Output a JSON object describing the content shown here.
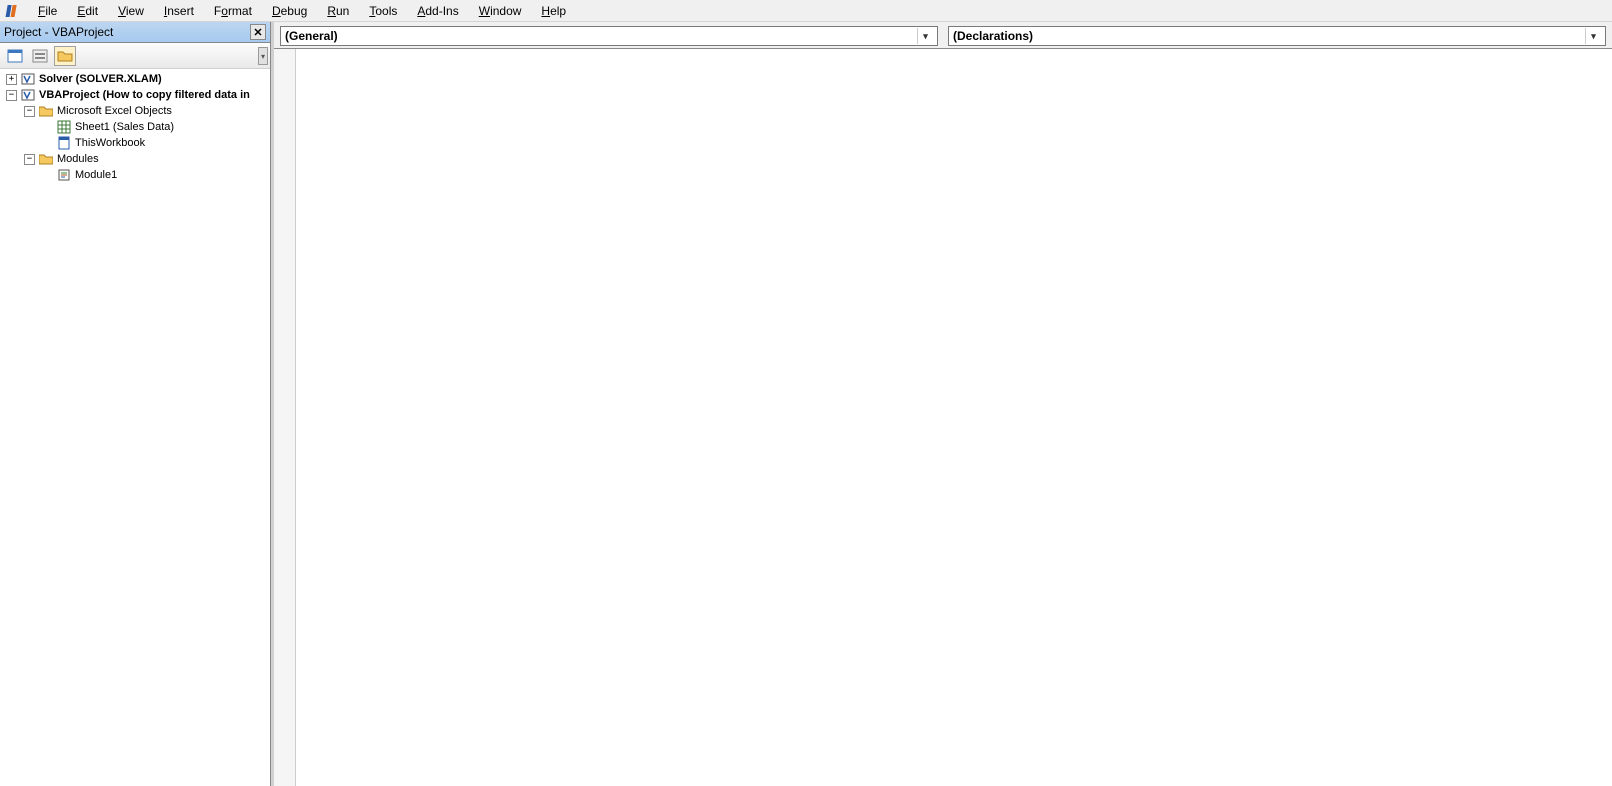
{
  "menubar": {
    "items": [
      {
        "label": "File",
        "accel": "F"
      },
      {
        "label": "Edit",
        "accel": "E"
      },
      {
        "label": "View",
        "accel": "V"
      },
      {
        "label": "Insert",
        "accel": "I"
      },
      {
        "label": "Format",
        "accel": "o"
      },
      {
        "label": "Debug",
        "accel": "D"
      },
      {
        "label": "Run",
        "accel": "R"
      },
      {
        "label": "Tools",
        "accel": "T"
      },
      {
        "label": "Add-Ins",
        "accel": "A"
      },
      {
        "label": "Window",
        "accel": "W"
      },
      {
        "label": "Help",
        "accel": "H"
      }
    ]
  },
  "project_panel": {
    "title": "Project - VBAProject",
    "close_symbol": "✕",
    "toolbar": {
      "view_code": "view-code-icon",
      "view_object": "view-object-icon",
      "toggle_folders": "folder-icon"
    },
    "tree": {
      "solver": {
        "expander": "+",
        "label": "Solver (SOLVER.XLAM)"
      },
      "vbaproject": {
        "expander": "−",
        "label": "VBAProject (How to copy filtered data in",
        "children": {
          "excel_objects": {
            "expander": "−",
            "label": "Microsoft Excel Objects",
            "sheet1": {
              "label": "Sheet1 (Sales Data)"
            },
            "thisworkbook": {
              "label": "ThisWorkbook"
            }
          },
          "modules": {
            "expander": "−",
            "label": "Modules",
            "module1": {
              "label": "Module1"
            }
          }
        }
      }
    }
  },
  "code_area": {
    "object_dropdown": "(General)",
    "procedure_dropdown": "(Declarations)"
  }
}
